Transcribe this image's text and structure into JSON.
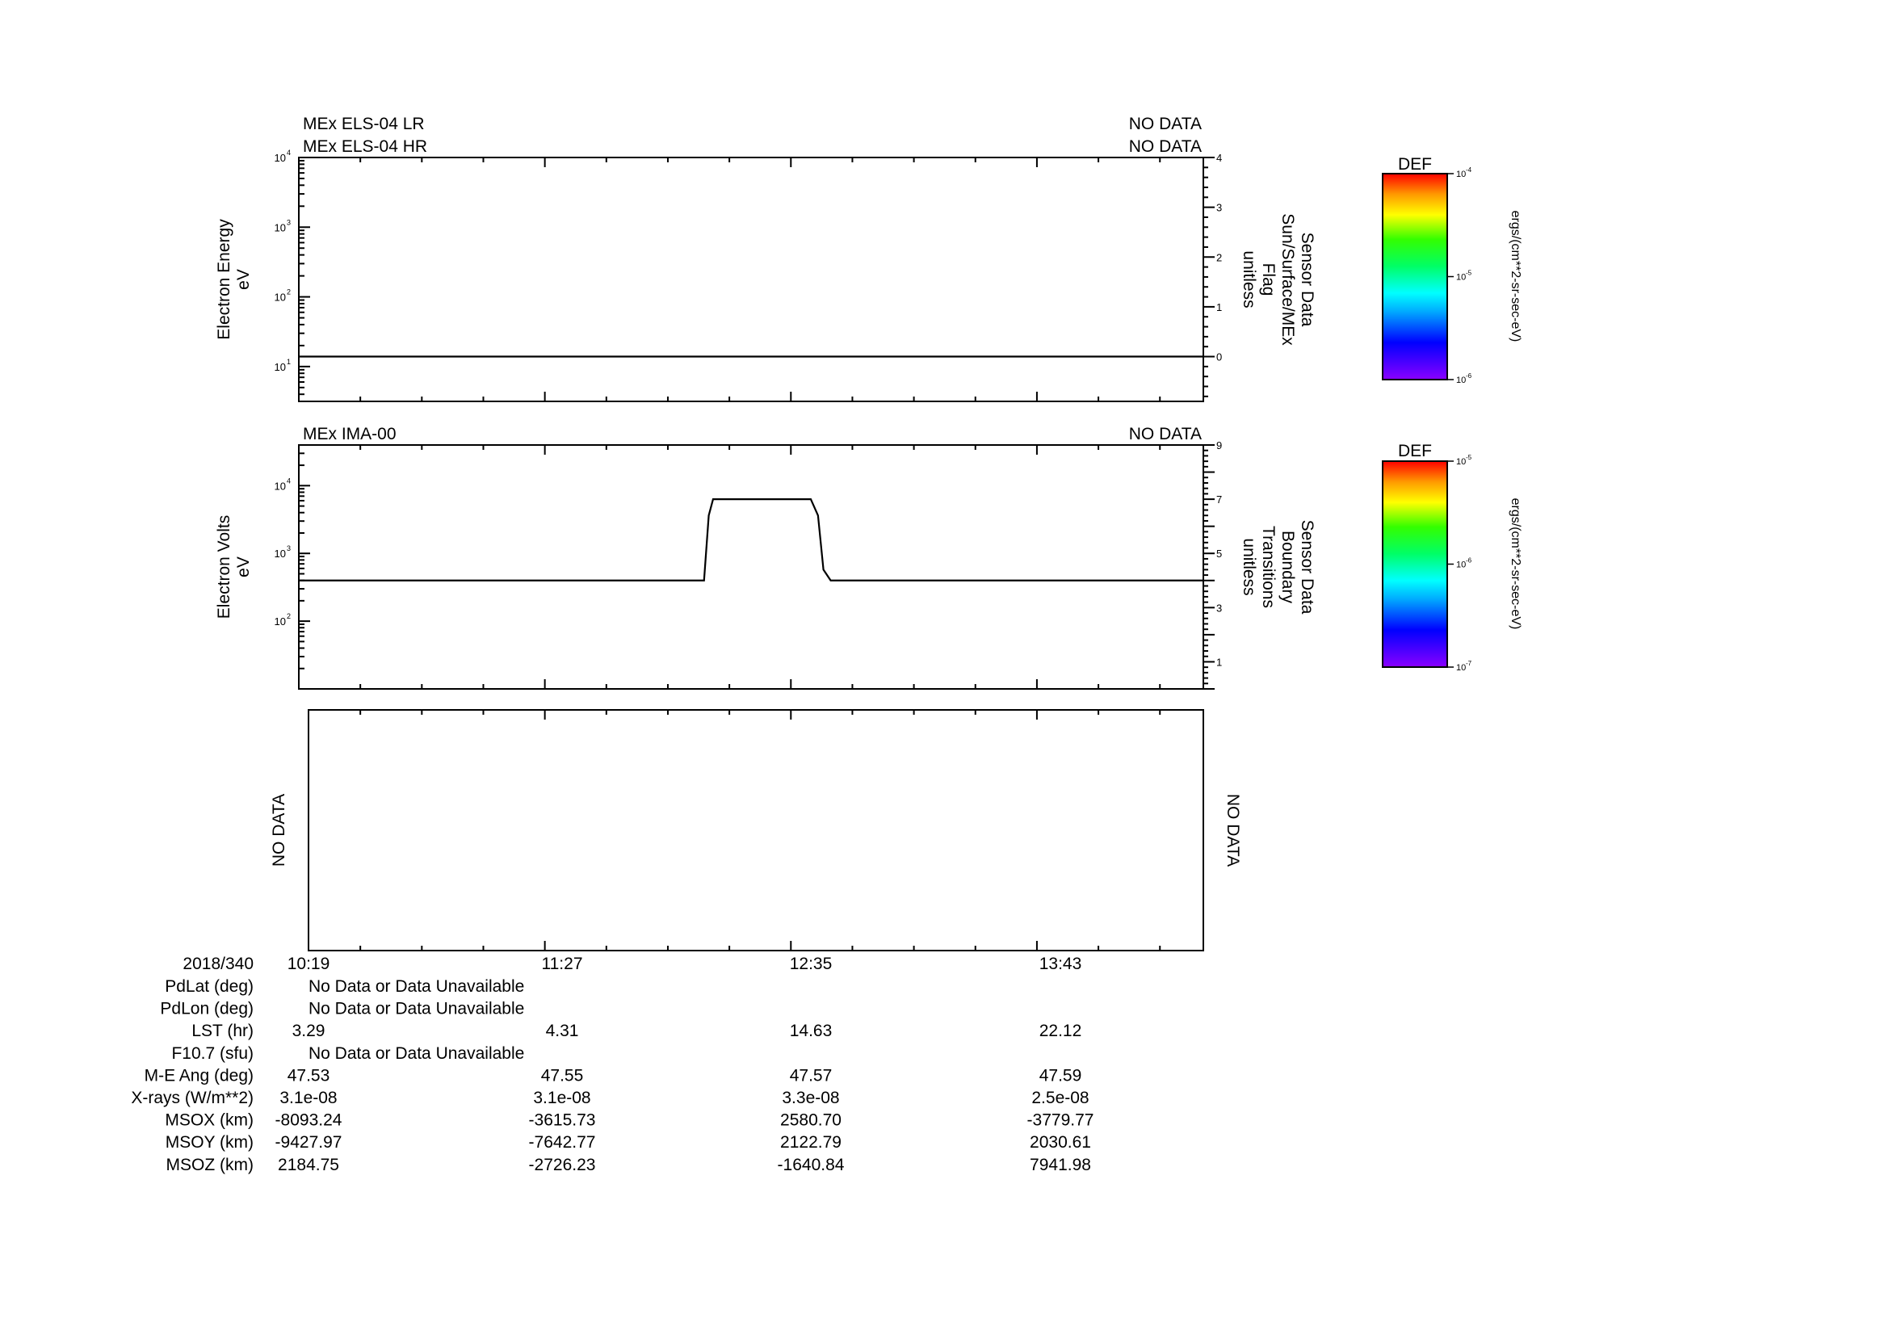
{
  "chart_data": [
    {
      "type": "line",
      "panel": "top",
      "headers_left": [
        "MEx ELS-04 LR",
        "MEx ELS-04 HR"
      ],
      "headers_right": [
        "NO DATA",
        "NO DATA"
      ],
      "ylabel": [
        "Electron Energy",
        "eV"
      ],
      "ylabel_right": [
        "Sensor Data",
        "Sun/Surface/MEx",
        "Flag",
        "unitless"
      ],
      "yscale": "log",
      "ylim_exp": [
        0.5,
        4
      ],
      "ytick_exps": [
        1,
        2,
        3,
        4
      ],
      "ytick_labels": [
        "10",
        "10",
        "10",
        "10"
      ],
      "ytick_sups": [
        "1",
        "2",
        "3",
        "4"
      ],
      "ylim_right": [
        -0.9,
        4
      ],
      "yticks_right": [
        "0",
        "1",
        "2",
        "3",
        "4"
      ],
      "series": [
        {
          "axis": "right",
          "x": [
            "10:19",
            "14:29"
          ],
          "y": [
            0,
            0
          ]
        }
      ],
      "colorbar": {
        "title": "DEF",
        "ticks": [
          "10",
          "10",
          "10"
        ],
        "tick_sups": [
          "-4",
          "-5",
          "-6"
        ],
        "unit": "ergs/(cm**2-sr-sec-eV)"
      }
    },
    {
      "type": "line",
      "panel": "middle",
      "headers_left": [
        "MEx IMA-00"
      ],
      "headers_right": [
        "NO DATA"
      ],
      "ylabel": [
        "Electron Volts",
        "eV"
      ],
      "ylabel_right": [
        "Sensor Data",
        "Boundary",
        "Transitions",
        "unitless"
      ],
      "yscale": "log",
      "ylim_exp": [
        1,
        4.6
      ],
      "ytick_exps": [
        2,
        3,
        4
      ],
      "ytick_labels": [
        "10",
        "10",
        "10"
      ],
      "ytick_sups": [
        "2",
        "3",
        "4"
      ],
      "ylim_right": [
        0,
        9
      ],
      "yticks_right": [
        "1",
        "3",
        "5",
        "7",
        "9"
      ],
      "series": [
        {
          "axis": "right",
          "x_minutes": [
            0,
            112,
            113.3,
            114.5,
            141.5,
            143.5,
            145,
            147,
            250
          ],
          "y": [
            4,
            4,
            6.4,
            7,
            7,
            6.4,
            4.4,
            4,
            4
          ]
        }
      ],
      "colorbar": {
        "title": "DEF",
        "ticks": [
          "10",
          "10",
          "10"
        ],
        "tick_sups": [
          "-5",
          "-6",
          "-7"
        ],
        "unit": "ergs/(cm**2-sr-sec-eV)"
      }
    },
    {
      "type": "line",
      "panel": "bottom",
      "left_text": "NO DATA",
      "right_text": "NO DATA",
      "series": []
    }
  ],
  "xaxis": {
    "range_minutes": [
      0,
      250
    ],
    "tick_minutes": [
      0,
      68,
      136,
      204
    ],
    "tick_labels": [
      "10:19",
      "11:27",
      "12:35",
      "13:43"
    ]
  },
  "ephemeris": {
    "date_label": "2018/340",
    "rows": [
      {
        "label": "PdLat (deg)",
        "values": [],
        "note": "No Data or Data Unavailable"
      },
      {
        "label": "PdLon (deg)",
        "values": [],
        "note": "No Data or Data Unavailable"
      },
      {
        "label": "LST (hr)",
        "values": [
          "3.29",
          "4.31",
          "14.63",
          "22.12"
        ]
      },
      {
        "label": "F10.7 (sfu)",
        "values": [],
        "note": "No Data or Data Unavailable"
      },
      {
        "label": "M-E Ang (deg)",
        "values": [
          "47.53",
          "47.55",
          "47.57",
          "47.59"
        ]
      },
      {
        "label": "X-rays (W/m**2)",
        "values": [
          "3.1e-08",
          "3.1e-08",
          "3.3e-08",
          "2.5e-08"
        ]
      },
      {
        "label": "MSOX (km)",
        "values": [
          "-8093.24",
          "-3615.73",
          "2580.70",
          "-3779.77"
        ]
      },
      {
        "label": "MSOY (km)",
        "values": [
          "-9427.97",
          "-7642.77",
          "2122.79",
          "2030.61"
        ]
      },
      {
        "label": "MSOZ (km)",
        "values": [
          "2184.75",
          "-2726.23",
          "-1640.84",
          "7941.98"
        ]
      }
    ]
  }
}
